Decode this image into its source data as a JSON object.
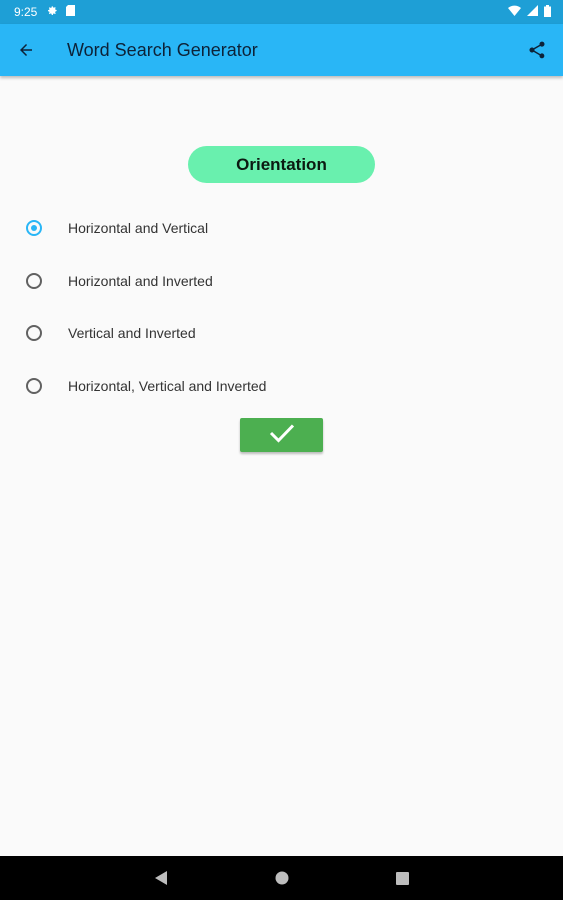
{
  "status_bar": {
    "time": "9:25",
    "left_icons": [
      "gear-icon",
      "sd-card-icon"
    ],
    "right_icons": [
      "wifi-icon",
      "cell-signal-icon",
      "battery-icon"
    ]
  },
  "app_bar": {
    "title": "Word Search Generator",
    "back_icon": "arrow-back-icon",
    "share_icon": "share-icon",
    "color": "#29b6f6"
  },
  "section": {
    "heading": "Orientation",
    "heading_color": "#69f0ae"
  },
  "options": [
    {
      "label": "Horizontal and Vertical",
      "selected": true
    },
    {
      "label": "Horizontal and Inverted",
      "selected": false
    },
    {
      "label": "Vertical and Inverted",
      "selected": false
    },
    {
      "label": "Horizontal, Vertical and Inverted",
      "selected": false
    }
  ],
  "confirm_button": {
    "icon": "check-icon",
    "color": "#4caf50"
  },
  "nav_bar": {
    "icons": [
      "back-triangle-icon",
      "home-circle-icon",
      "recents-square-icon"
    ]
  }
}
